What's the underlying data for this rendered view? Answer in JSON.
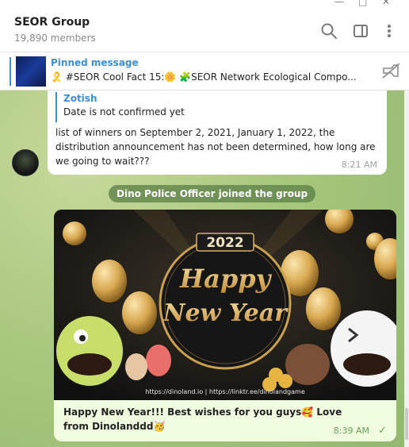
{
  "header": {
    "title": "SEOR Group",
    "members": "19,890 members"
  },
  "window_controls": {
    "minimize": "—",
    "maximize": "□",
    "close": "✕"
  },
  "pinned": {
    "title": "Pinned message",
    "text": "🎗️ #SEOR Cool Fact 15:🌼 🧩SEOR Network Ecological Compo..."
  },
  "messages": [
    {
      "reply_to": {
        "name": "Zotish",
        "text": "Date is not confirmed yet"
      },
      "text": "list of winners on September 2, 2021, January 1, 2022, the distribution announcement has not been determined, how long are we going to wait???",
      "time": "8:21 AM"
    }
  ],
  "system_message": "Dino Police Officer joined the group",
  "image_message": {
    "image": {
      "year": "2022",
      "line1": "Happy",
      "line2": "New Year",
      "footer": "https://dinoland.io  |  https://linktr.ee/dinolandgame"
    },
    "caption": "Happy New Year!!! Best wishes for you guys🥰 Love from Dinolanddd🥳",
    "time": "8:39 AM",
    "status": "✓"
  },
  "icons": {
    "search": "search-icon",
    "sidebar": "sidebar-toggle-icon",
    "more": "more-vertical-icon",
    "unpin": "unpin-icon"
  },
  "colors": {
    "accent": "#3a8fd6",
    "chat_bg": "#a9c77f",
    "outgoing_bubble": "#effdde",
    "system_pill": "#5a7d46"
  }
}
